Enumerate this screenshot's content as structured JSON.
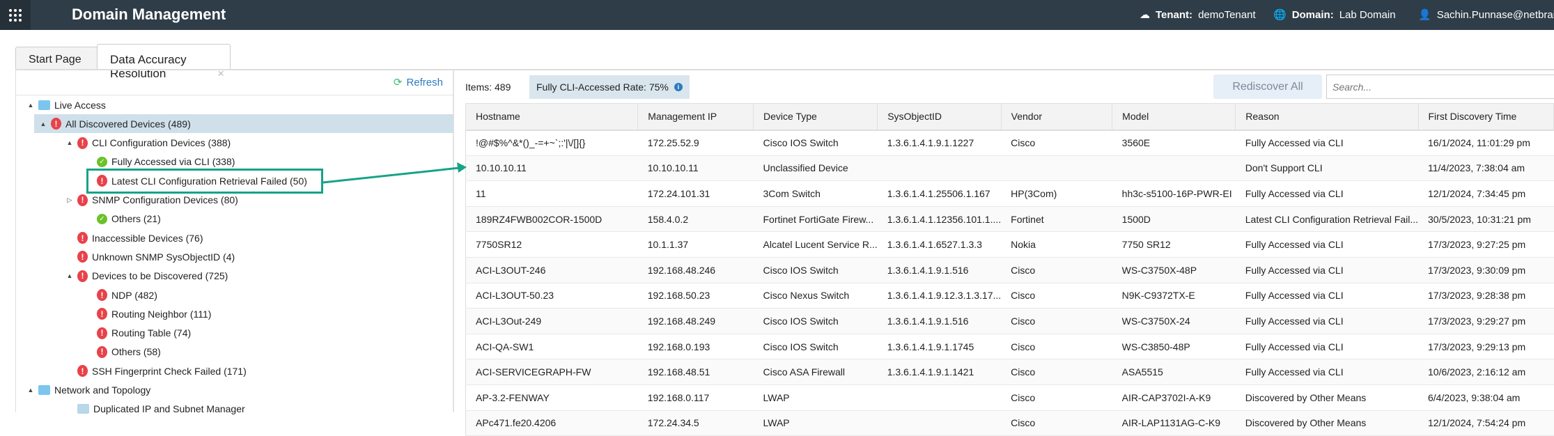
{
  "header": {
    "title": "Domain Management",
    "tenant_label": "Tenant:",
    "tenant": "demoTenant",
    "domain_label": "Domain:",
    "domain": "Lab Domain",
    "user": "Sachin.Punnase@netbrain"
  },
  "tabs": [
    {
      "label": "Start Page"
    },
    {
      "label": "Data Accuracy Resolution",
      "close": "×"
    }
  ],
  "left": {
    "refresh": "Refresh",
    "tree": [
      {
        "label": "Live Access",
        "icon": "folder-alert",
        "level": 0,
        "expand": "▲"
      },
      {
        "label": "All Discovered Devices (489)",
        "icon": "error",
        "level": 1,
        "expand": "▲",
        "selected": true
      },
      {
        "label": "CLI Configuration Devices (388)",
        "icon": "error",
        "level": 2,
        "expand": "▲"
      },
      {
        "label": "Fully Accessed via CLI (338)",
        "icon": "ok",
        "level": 3
      },
      {
        "label": "Latest CLI Configuration Retrieval Failed (50)",
        "icon": "error",
        "level": 3,
        "highlighted": true
      },
      {
        "label": "SNMP Configuration Devices (80)",
        "icon": "error",
        "level": 2,
        "expand": "▷"
      },
      {
        "label": "Others (21)",
        "icon": "ok",
        "level": 3
      },
      {
        "label": "Inaccessible Devices (76)",
        "icon": "error",
        "level": 2
      },
      {
        "label": "Unknown SNMP SysObjectID (4)",
        "icon": "error",
        "level": 2
      },
      {
        "label": "Devices to be Discovered (725)",
        "icon": "error",
        "level": 2,
        "expand": "▲"
      },
      {
        "label": "NDP (482)",
        "icon": "error",
        "level": 3
      },
      {
        "label": "Routing Neighbor (111)",
        "icon": "error",
        "level": 3
      },
      {
        "label": "Routing Table (74)",
        "icon": "error",
        "level": 3
      },
      {
        "label": "Others (58)",
        "icon": "error",
        "level": 3
      },
      {
        "label": "SSH Fingerprint Check Failed (171)",
        "icon": "error",
        "level": 2
      },
      {
        "label": "Network and Topology",
        "icon": "folder",
        "level": 0,
        "expand": "▲"
      },
      {
        "label": "Duplicated IP and Subnet Manager",
        "icon": "grid",
        "level": 2
      }
    ]
  },
  "main": {
    "items": "Items: 489",
    "rate": "Fully CLI-Accessed Rate: 75%",
    "rediscover": "Rediscover All",
    "search_placeholder": "Search...",
    "columns": [
      "Hostname",
      "Management IP",
      "Device Type",
      "SysObjectID",
      "Vendor",
      "Model",
      "Reason",
      "First Discovery Time"
    ],
    "rows": [
      [
        "!@#$%^&*()_-=+~`;:'|\\/[]{}",
        "172.25.52.9",
        "Cisco IOS Switch",
        "1.3.6.1.4.1.9.1.1227",
        "Cisco",
        "3560E",
        "Fully Accessed via CLI",
        "16/1/2024, 11:01:29 pm"
      ],
      [
        "10.10.10.11",
        "10.10.10.11",
        "Unclassified Device",
        "",
        "",
        "",
        "Don't Support CLI",
        "11/4/2023, 7:38:04 am"
      ],
      [
        "11",
        "172.24.101.31",
        "3Com Switch",
        "1.3.6.1.4.1.25506.1.167",
        "HP(3Com)",
        "hh3c-s5100-16P-PWR-EI",
        "Fully Accessed via CLI",
        "12/1/2024, 7:34:45 pm"
      ],
      [
        "189RZ4FWB002COR-1500D",
        "158.4.0.2",
        "Fortinet FortiGate Firew...",
        "1.3.6.1.4.1.12356.101.1....",
        "Fortinet",
        "1500D",
        "Latest CLI Configuration Retrieval Fail...",
        "30/5/2023, 10:31:21 pm"
      ],
      [
        "7750SR12",
        "10.1.1.37",
        "Alcatel Lucent Service R...",
        "1.3.6.1.4.1.6527.1.3.3",
        "Nokia",
        "7750 SR12",
        "Fully Accessed via CLI",
        "17/3/2023, 9:27:25 pm"
      ],
      [
        "ACI-L3OUT-246",
        "192.168.48.246",
        "Cisco IOS Switch",
        "1.3.6.1.4.1.9.1.516",
        "Cisco",
        "WS-C3750X-48P",
        "Fully Accessed via CLI",
        "17/3/2023, 9:30:09 pm"
      ],
      [
        "ACI-L3OUT-50.23",
        "192.168.50.23",
        "Cisco Nexus Switch",
        "1.3.6.1.4.1.9.12.3.1.3.17...",
        "Cisco",
        "N9K-C9372TX-E",
        "Fully Accessed via CLI",
        "17/3/2023, 9:28:38 pm"
      ],
      [
        "ACI-L3Out-249",
        "192.168.48.249",
        "Cisco IOS Switch",
        "1.3.6.1.4.1.9.1.516",
        "Cisco",
        "WS-C3750X-24",
        "Fully Accessed via CLI",
        "17/3/2023, 9:29:27 pm"
      ],
      [
        "ACI-QA-SW1",
        "192.168.0.193",
        "Cisco IOS Switch",
        "1.3.6.1.4.1.9.1.1745",
        "Cisco",
        "WS-C3850-48P",
        "Fully Accessed via CLI",
        "17/3/2023, 9:29:13 pm"
      ],
      [
        "ACI-SERVICEGRAPH-FW",
        "192.168.48.51",
        "Cisco ASA Firewall",
        "1.3.6.1.4.1.9.1.1421",
        "Cisco",
        "ASA5515",
        "Fully Accessed via CLI",
        "10/6/2023, 2:16:12 am"
      ],
      [
        "AP-3.2-FENWAY",
        "192.168.0.117",
        "LWAP",
        "",
        "Cisco",
        "AIR-CAP3702I-A-K9",
        "Discovered by Other Means",
        "6/4/2023, 9:38:04 am"
      ],
      [
        "APc471.fe20.4206",
        "172.24.34.5",
        "LWAP",
        "",
        "Cisco",
        "AIR-LAP1131AG-C-K9",
        "Discovered by Other Means",
        "12/1/2024, 7:54:24 pm"
      ]
    ]
  },
  "colors": {
    "header": "#2f3d48",
    "highlight": "#16a387",
    "error": "#e8424a",
    "ok": "#6cc12a"
  }
}
